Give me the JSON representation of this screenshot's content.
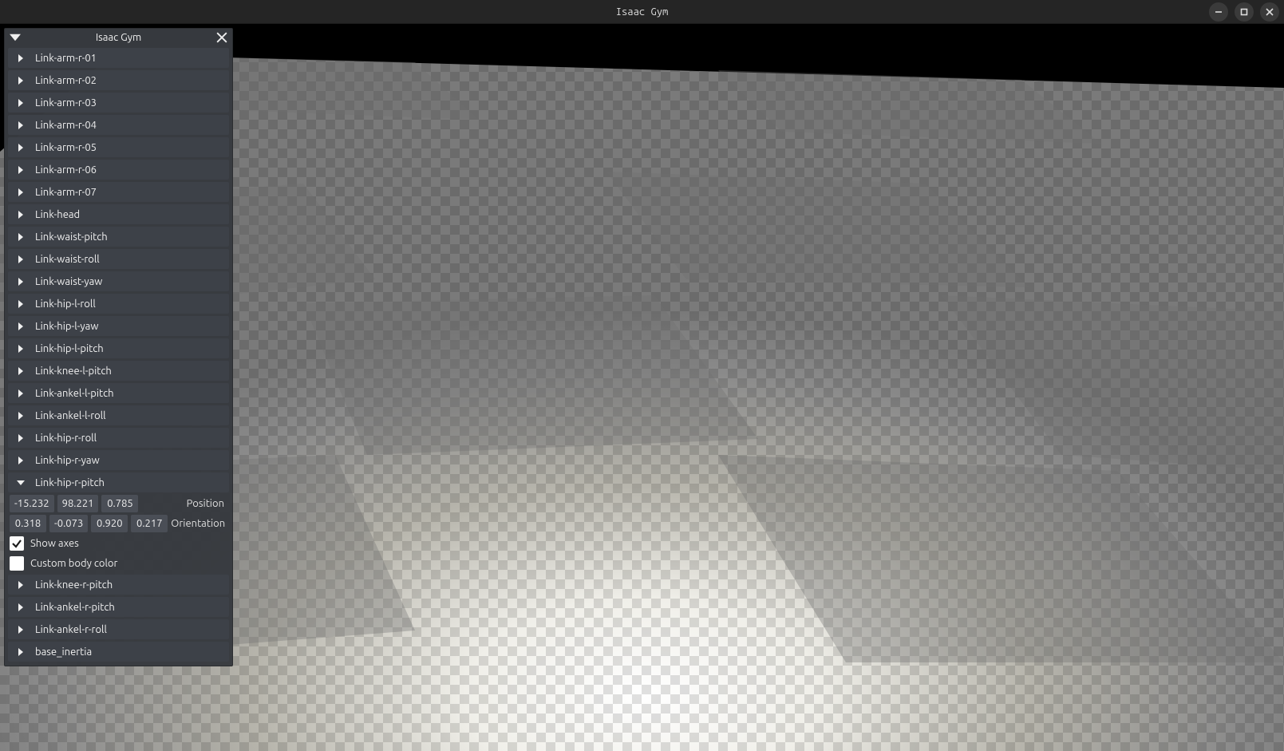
{
  "window": {
    "title": "Isaac Gym"
  },
  "panel": {
    "title": "Isaac Gym"
  },
  "tree": {
    "items": [
      {
        "label": "Link-arm-r-01",
        "expanded": false
      },
      {
        "label": "Link-arm-r-02",
        "expanded": false
      },
      {
        "label": "Link-arm-r-03",
        "expanded": false
      },
      {
        "label": "Link-arm-r-04",
        "expanded": false
      },
      {
        "label": "Link-arm-r-05",
        "expanded": false
      },
      {
        "label": "Link-arm-r-06",
        "expanded": false
      },
      {
        "label": "Link-arm-r-07",
        "expanded": false
      },
      {
        "label": "Link-head",
        "expanded": false
      },
      {
        "label": "Link-waist-pitch",
        "expanded": false
      },
      {
        "label": "Link-waist-roll",
        "expanded": false
      },
      {
        "label": "Link-waist-yaw",
        "expanded": false
      },
      {
        "label": "Link-hip-l-roll",
        "expanded": false
      },
      {
        "label": "Link-hip-l-yaw",
        "expanded": false
      },
      {
        "label": "Link-hip-l-pitch",
        "expanded": false
      },
      {
        "label": "Link-knee-l-pitch",
        "expanded": false
      },
      {
        "label": "Link-ankel-l-pitch",
        "expanded": false
      },
      {
        "label": "Link-ankel-l-roll",
        "expanded": false
      },
      {
        "label": "Link-hip-r-roll",
        "expanded": false
      },
      {
        "label": "Link-hip-r-yaw",
        "expanded": false
      },
      {
        "label": "Link-hip-r-pitch",
        "expanded": true,
        "position": [
          "-15.232",
          "98.221",
          "0.785"
        ],
        "position_label": "Position",
        "orientation": [
          "0.318",
          "-0.073",
          "0.920",
          "0.217"
        ],
        "orientation_label": "Orientation",
        "show_axes": {
          "label": "Show axes",
          "checked": true
        },
        "custom_body_color": {
          "label": "Custom body color",
          "checked": false,
          "swatch": "#ffffff"
        }
      },
      {
        "label": "Link-knee-r-pitch",
        "expanded": false
      },
      {
        "label": "Link-ankel-r-pitch",
        "expanded": false
      },
      {
        "label": "Link-ankel-r-roll",
        "expanded": false
      },
      {
        "label": "base_inertia",
        "expanded": false
      }
    ]
  }
}
